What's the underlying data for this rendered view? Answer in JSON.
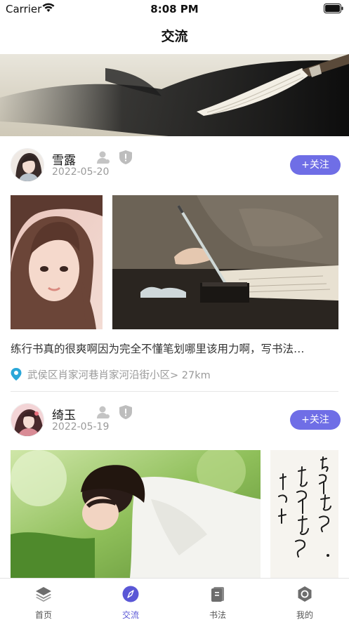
{
  "status_bar": {
    "carrier": "Carrier",
    "time": "8:08 PM"
  },
  "nav": {
    "title": "交流"
  },
  "posts": [
    {
      "username": "雪露",
      "date": "2022-05-20",
      "follow_label": "+关注",
      "text": "练行书真的很爽啊因为完全不懂笔划哪里该用力啊，写书法…",
      "location": "武侯区肖家河巷肖家河沿街小区> 27km"
    },
    {
      "username": "绮玉",
      "date": "2022-05-19",
      "follow_label": "+关注"
    }
  ],
  "tabbar": {
    "items": [
      {
        "label": "首页",
        "icon": "layers-icon"
      },
      {
        "label": "交流",
        "icon": "compass-icon",
        "active": true
      },
      {
        "label": "书法",
        "icon": "book-icon"
      },
      {
        "label": "我的",
        "icon": "profile-icon"
      }
    ]
  },
  "colors": {
    "accent": "#6f6ee6",
    "active_tab": "#5a57d6"
  }
}
